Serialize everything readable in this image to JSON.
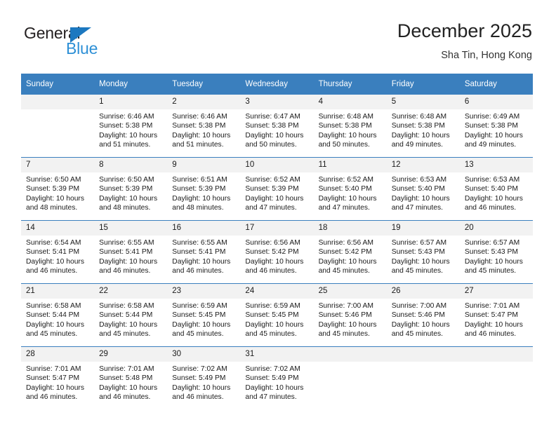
{
  "logo": {
    "word_one": "General",
    "word_two": "Blue",
    "triangle_color": "#1c78c0",
    "word_two_color": "#2e90d6"
  },
  "header": {
    "title": "December 2025",
    "subtitle": "Sha Tin, Hong Kong"
  },
  "theme": {
    "header_row_bg": "#3a7fbe",
    "header_row_text": "#ffffff",
    "daynum_bg": "#f2f2f2",
    "row_divider": "#3a7fbe"
  },
  "calendar": {
    "weekday_headers": [
      "Sunday",
      "Monday",
      "Tuesday",
      "Wednesday",
      "Thursday",
      "Friday",
      "Saturday"
    ],
    "weeks": [
      [
        {
          "day": "",
          "sunrise": "",
          "sunset": "",
          "daylight_line1": "",
          "daylight_line2": ""
        },
        {
          "day": "1",
          "sunrise": "Sunrise: 6:46 AM",
          "sunset": "Sunset: 5:38 PM",
          "daylight_line1": "Daylight: 10 hours",
          "daylight_line2": "and 51 minutes."
        },
        {
          "day": "2",
          "sunrise": "Sunrise: 6:46 AM",
          "sunset": "Sunset: 5:38 PM",
          "daylight_line1": "Daylight: 10 hours",
          "daylight_line2": "and 51 minutes."
        },
        {
          "day": "3",
          "sunrise": "Sunrise: 6:47 AM",
          "sunset": "Sunset: 5:38 PM",
          "daylight_line1": "Daylight: 10 hours",
          "daylight_line2": "and 50 minutes."
        },
        {
          "day": "4",
          "sunrise": "Sunrise: 6:48 AM",
          "sunset": "Sunset: 5:38 PM",
          "daylight_line1": "Daylight: 10 hours",
          "daylight_line2": "and 50 minutes."
        },
        {
          "day": "5",
          "sunrise": "Sunrise: 6:48 AM",
          "sunset": "Sunset: 5:38 PM",
          "daylight_line1": "Daylight: 10 hours",
          "daylight_line2": "and 49 minutes."
        },
        {
          "day": "6",
          "sunrise": "Sunrise: 6:49 AM",
          "sunset": "Sunset: 5:38 PM",
          "daylight_line1": "Daylight: 10 hours",
          "daylight_line2": "and 49 minutes."
        }
      ],
      [
        {
          "day": "7",
          "sunrise": "Sunrise: 6:50 AM",
          "sunset": "Sunset: 5:39 PM",
          "daylight_line1": "Daylight: 10 hours",
          "daylight_line2": "and 48 minutes."
        },
        {
          "day": "8",
          "sunrise": "Sunrise: 6:50 AM",
          "sunset": "Sunset: 5:39 PM",
          "daylight_line1": "Daylight: 10 hours",
          "daylight_line2": "and 48 minutes."
        },
        {
          "day": "9",
          "sunrise": "Sunrise: 6:51 AM",
          "sunset": "Sunset: 5:39 PM",
          "daylight_line1": "Daylight: 10 hours",
          "daylight_line2": "and 48 minutes."
        },
        {
          "day": "10",
          "sunrise": "Sunrise: 6:52 AM",
          "sunset": "Sunset: 5:39 PM",
          "daylight_line1": "Daylight: 10 hours",
          "daylight_line2": "and 47 minutes."
        },
        {
          "day": "11",
          "sunrise": "Sunrise: 6:52 AM",
          "sunset": "Sunset: 5:40 PM",
          "daylight_line1": "Daylight: 10 hours",
          "daylight_line2": "and 47 minutes."
        },
        {
          "day": "12",
          "sunrise": "Sunrise: 6:53 AM",
          "sunset": "Sunset: 5:40 PM",
          "daylight_line1": "Daylight: 10 hours",
          "daylight_line2": "and 47 minutes."
        },
        {
          "day": "13",
          "sunrise": "Sunrise: 6:53 AM",
          "sunset": "Sunset: 5:40 PM",
          "daylight_line1": "Daylight: 10 hours",
          "daylight_line2": "and 46 minutes."
        }
      ],
      [
        {
          "day": "14",
          "sunrise": "Sunrise: 6:54 AM",
          "sunset": "Sunset: 5:41 PM",
          "daylight_line1": "Daylight: 10 hours",
          "daylight_line2": "and 46 minutes."
        },
        {
          "day": "15",
          "sunrise": "Sunrise: 6:55 AM",
          "sunset": "Sunset: 5:41 PM",
          "daylight_line1": "Daylight: 10 hours",
          "daylight_line2": "and 46 minutes."
        },
        {
          "day": "16",
          "sunrise": "Sunrise: 6:55 AM",
          "sunset": "Sunset: 5:41 PM",
          "daylight_line1": "Daylight: 10 hours",
          "daylight_line2": "and 46 minutes."
        },
        {
          "day": "17",
          "sunrise": "Sunrise: 6:56 AM",
          "sunset": "Sunset: 5:42 PM",
          "daylight_line1": "Daylight: 10 hours",
          "daylight_line2": "and 46 minutes."
        },
        {
          "day": "18",
          "sunrise": "Sunrise: 6:56 AM",
          "sunset": "Sunset: 5:42 PM",
          "daylight_line1": "Daylight: 10 hours",
          "daylight_line2": "and 45 minutes."
        },
        {
          "day": "19",
          "sunrise": "Sunrise: 6:57 AM",
          "sunset": "Sunset: 5:43 PM",
          "daylight_line1": "Daylight: 10 hours",
          "daylight_line2": "and 45 minutes."
        },
        {
          "day": "20",
          "sunrise": "Sunrise: 6:57 AM",
          "sunset": "Sunset: 5:43 PM",
          "daylight_line1": "Daylight: 10 hours",
          "daylight_line2": "and 45 minutes."
        }
      ],
      [
        {
          "day": "21",
          "sunrise": "Sunrise: 6:58 AM",
          "sunset": "Sunset: 5:44 PM",
          "daylight_line1": "Daylight: 10 hours",
          "daylight_line2": "and 45 minutes."
        },
        {
          "day": "22",
          "sunrise": "Sunrise: 6:58 AM",
          "sunset": "Sunset: 5:44 PM",
          "daylight_line1": "Daylight: 10 hours",
          "daylight_line2": "and 45 minutes."
        },
        {
          "day": "23",
          "sunrise": "Sunrise: 6:59 AM",
          "sunset": "Sunset: 5:45 PM",
          "daylight_line1": "Daylight: 10 hours",
          "daylight_line2": "and 45 minutes."
        },
        {
          "day": "24",
          "sunrise": "Sunrise: 6:59 AM",
          "sunset": "Sunset: 5:45 PM",
          "daylight_line1": "Daylight: 10 hours",
          "daylight_line2": "and 45 minutes."
        },
        {
          "day": "25",
          "sunrise": "Sunrise: 7:00 AM",
          "sunset": "Sunset: 5:46 PM",
          "daylight_line1": "Daylight: 10 hours",
          "daylight_line2": "and 45 minutes."
        },
        {
          "day": "26",
          "sunrise": "Sunrise: 7:00 AM",
          "sunset": "Sunset: 5:46 PM",
          "daylight_line1": "Daylight: 10 hours",
          "daylight_line2": "and 45 minutes."
        },
        {
          "day": "27",
          "sunrise": "Sunrise: 7:01 AM",
          "sunset": "Sunset: 5:47 PM",
          "daylight_line1": "Daylight: 10 hours",
          "daylight_line2": "and 46 minutes."
        }
      ],
      [
        {
          "day": "28",
          "sunrise": "Sunrise: 7:01 AM",
          "sunset": "Sunset: 5:47 PM",
          "daylight_line1": "Daylight: 10 hours",
          "daylight_line2": "and 46 minutes."
        },
        {
          "day": "29",
          "sunrise": "Sunrise: 7:01 AM",
          "sunset": "Sunset: 5:48 PM",
          "daylight_line1": "Daylight: 10 hours",
          "daylight_line2": "and 46 minutes."
        },
        {
          "day": "30",
          "sunrise": "Sunrise: 7:02 AM",
          "sunset": "Sunset: 5:49 PM",
          "daylight_line1": "Daylight: 10 hours",
          "daylight_line2": "and 46 minutes."
        },
        {
          "day": "31",
          "sunrise": "Sunrise: 7:02 AM",
          "sunset": "Sunset: 5:49 PM",
          "daylight_line1": "Daylight: 10 hours",
          "daylight_line2": "and 47 minutes."
        },
        {
          "day": "",
          "sunrise": "",
          "sunset": "",
          "daylight_line1": "",
          "daylight_line2": ""
        },
        {
          "day": "",
          "sunrise": "",
          "sunset": "",
          "daylight_line1": "",
          "daylight_line2": ""
        },
        {
          "day": "",
          "sunrise": "",
          "sunset": "",
          "daylight_line1": "",
          "daylight_line2": ""
        }
      ]
    ]
  }
}
